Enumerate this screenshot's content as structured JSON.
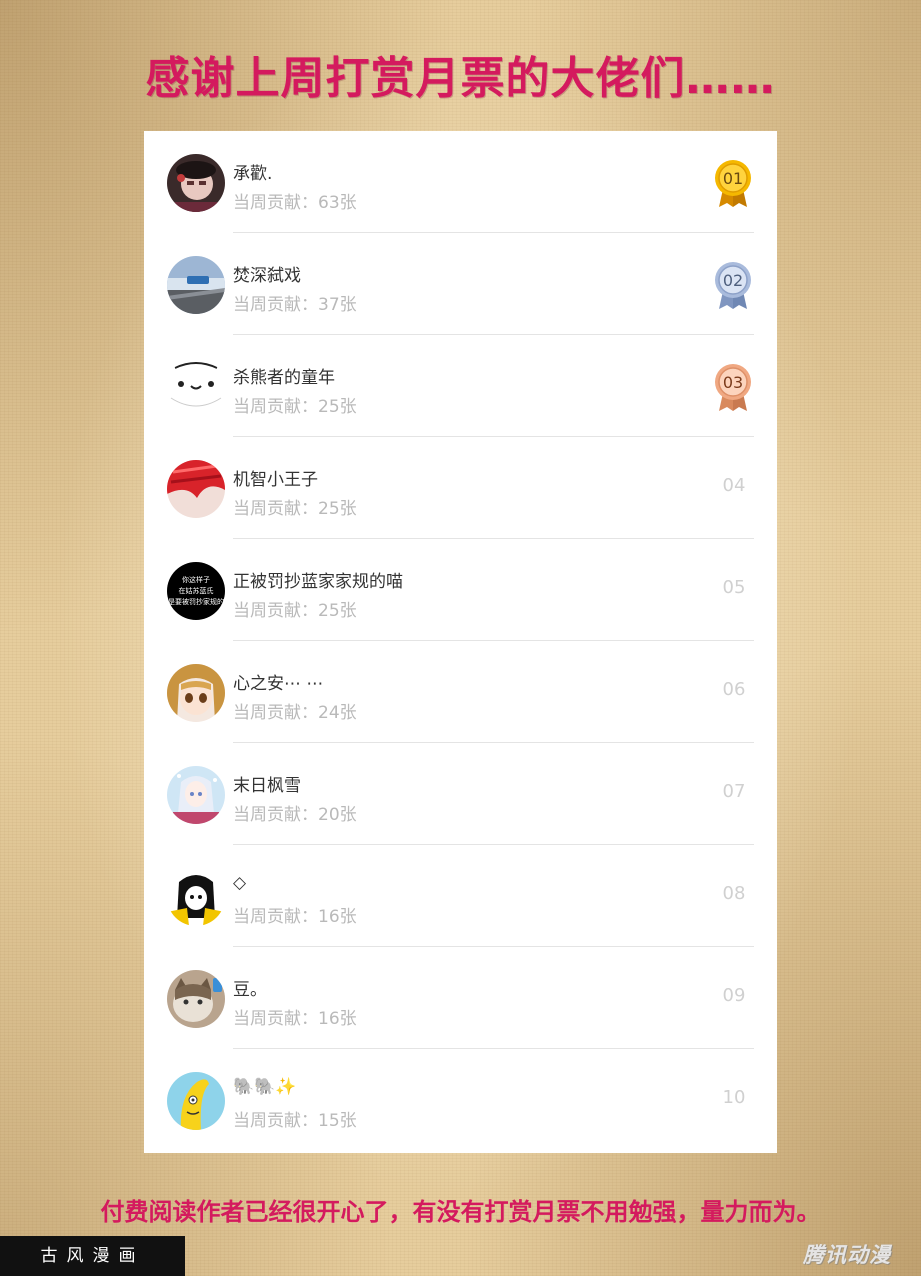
{
  "title": "感谢上周打赏月票的大佬们……",
  "contribution_label": "当周贡献：",
  "ranking": [
    {
      "rank": "01",
      "name": "承歡.",
      "count": "63张",
      "medal": "gold"
    },
    {
      "rank": "02",
      "name": "焚深弑戏",
      "count": "37张",
      "medal": "silver"
    },
    {
      "rank": "03",
      "name": "杀熊者的童年",
      "count": "25张",
      "medal": "bronze"
    },
    {
      "rank": "04",
      "name": "机智小王子",
      "count": "25张"
    },
    {
      "rank": "05",
      "name": "正被罚抄蓝家家规的喵",
      "count": "25张",
      "avatar_text": [
        "你这样子",
        "在姑苏蓝氏",
        "是要被罚抄家规的"
      ]
    },
    {
      "rank": "06",
      "name": "心之安⋯ ⋯",
      "count": "24张"
    },
    {
      "rank": "07",
      "name": "末日枫雪",
      "count": "20张"
    },
    {
      "rank": "08",
      "name": "◇",
      "count": "16张"
    },
    {
      "rank": "09",
      "name": "豆。",
      "count": "16张"
    },
    {
      "rank": "10",
      "name": "🐘🐘✨",
      "count": "15张"
    }
  ],
  "footer_note": "付费阅读作者已经很开心了，有没有打赏月票不用勉强，量力而为。",
  "corner_badge": "古风漫画",
  "watermark": "腾讯动漫",
  "colors": {
    "title": "#d41a5e",
    "gold": "#f2b705",
    "silver": "#9fb2d6",
    "bronze": "#f0a882"
  }
}
